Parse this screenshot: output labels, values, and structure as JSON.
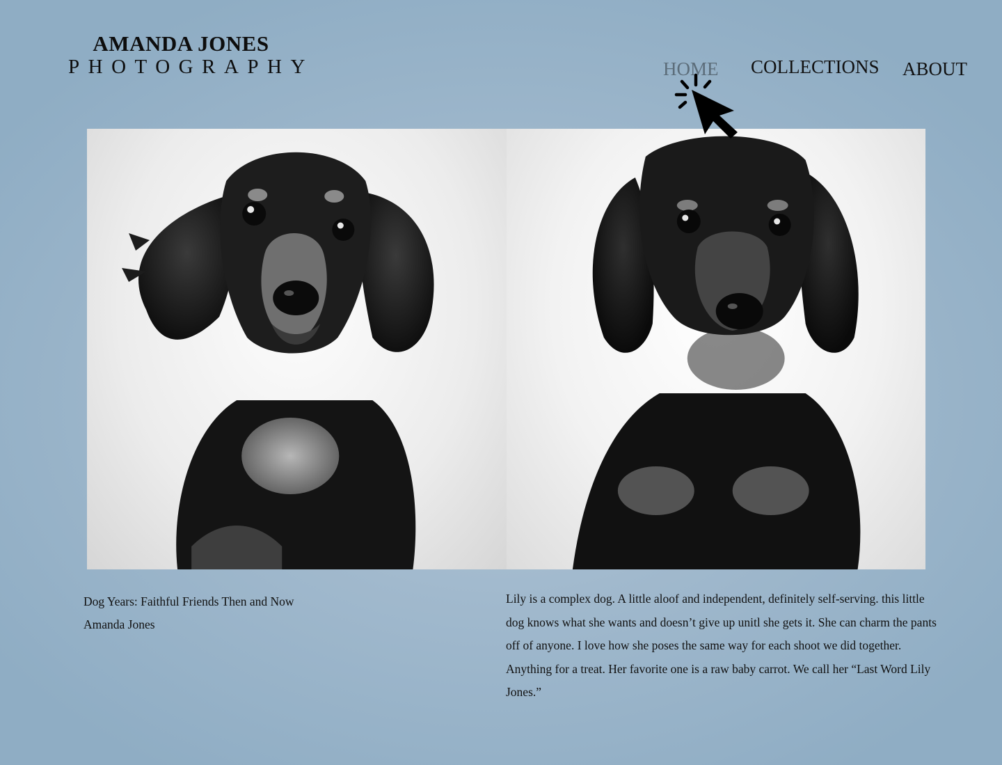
{
  "logo": {
    "line1": "AMANDA JONES",
    "line2": "PHOTOGRAPHY"
  },
  "nav": {
    "home": "HOME",
    "collections": "COLLECTIONS",
    "about": "ABOUT",
    "active_color": "#5c6d7a"
  },
  "cursor": {
    "icon": "click-pointer-icon"
  },
  "photo": {
    "icon_left": "dachshund-puppy-photo",
    "icon_right": "dachshund-adult-photo"
  },
  "caption": {
    "title": "Dog Years: Faithful Friends Then and Now",
    "author": "Amanda Jones",
    "description": "Lily is a complex dog. A little aloof and independent, definitely self-serving. this little dog knows what she wants and doesn’t give up unitl she gets it. She can charm the pants off of anyone. I love how she poses the same way for each shoot we did together. Anything for a treat. Her favorite one is a raw baby carrot. We call her “Last Word Lily Jones.”"
  },
  "colors": {
    "background": "#9bb4c9",
    "text": "#111111"
  }
}
